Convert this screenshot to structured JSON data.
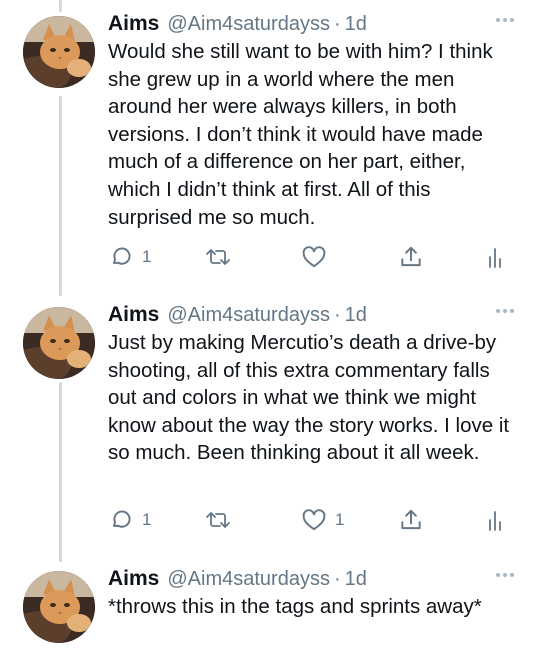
{
  "tweets": [
    {
      "name": "Aims",
      "handle": "@Aim4saturdayss",
      "separator": "·",
      "time": "1d",
      "text": "Would she still want to be with him? I think she grew up in a world where the men around her were always killers, in both versions. I don’t think it would have made much of a difference on her part, either, which I didn’t think at first. All of this surprised me so much.",
      "reply_count": "1",
      "retweet_count": "",
      "like_count": "",
      "icons": [
        "reply-icon",
        "retweet-icon",
        "like-icon",
        "share-icon",
        "analytics-icon"
      ]
    },
    {
      "name": "Aims",
      "handle": "@Aim4saturdayss",
      "separator": "·",
      "time": "1d",
      "text": "Just by making Mercutio’s death a drive-by shooting, all of this extra commentary falls out and colors in what we think we might know about the way the story works. I love it so much. Been thinking about it all week.",
      "reply_count": "1",
      "retweet_count": "",
      "like_count": "1",
      "icons": [
        "reply-icon",
        "retweet-icon",
        "like-icon",
        "share-icon",
        "analytics-icon"
      ]
    },
    {
      "name": "Aims",
      "handle": "@Aim4saturdayss",
      "separator": "·",
      "time": "1d",
      "text": "*throws this in the tags and sprints away*"
    }
  ],
  "colors": {
    "text": "#0f1419",
    "muted": "#657786",
    "thread_line": "#cfd9de"
  }
}
